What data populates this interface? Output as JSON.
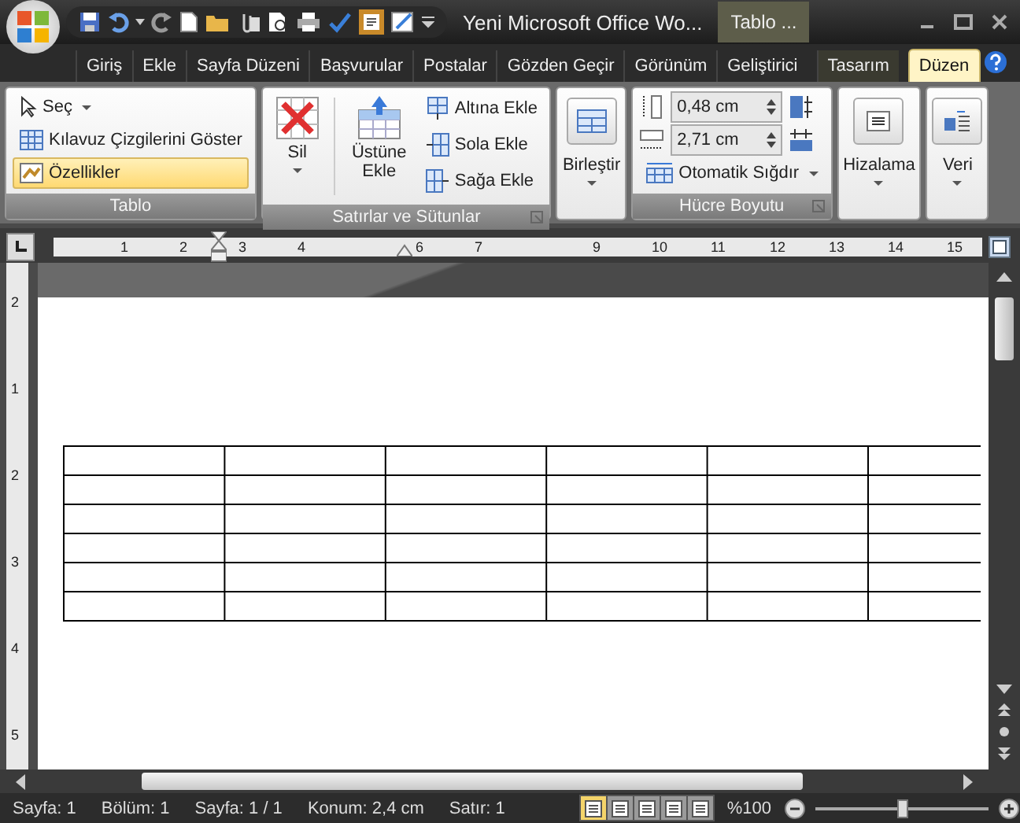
{
  "window": {
    "title": "Yeni Microsoft Office Wo...",
    "context_tab": "Tablo ..."
  },
  "tabs": [
    {
      "label": "Giriş",
      "selected": false,
      "kind": "main"
    },
    {
      "label": "Ekle",
      "selected": false,
      "kind": "main"
    },
    {
      "label": "Sayfa Düzeni",
      "selected": false,
      "kind": "main"
    },
    {
      "label": "Başvurular",
      "selected": false,
      "kind": "main"
    },
    {
      "label": "Postalar",
      "selected": false,
      "kind": "main"
    },
    {
      "label": "Gözden Geçir",
      "selected": false,
      "kind": "main"
    },
    {
      "label": "Görünüm",
      "selected": false,
      "kind": "main"
    },
    {
      "label": "Geliştirici",
      "selected": false,
      "kind": "main"
    },
    {
      "label": "Tasarım",
      "selected": false,
      "kind": "context"
    },
    {
      "label": "Düzen",
      "selected": true,
      "kind": "context"
    }
  ],
  "ribbon": {
    "table_group": {
      "label": "Tablo",
      "items": [
        {
          "label": "Seç",
          "kind": "dropdown",
          "selected": false
        },
        {
          "label": "Kılavuz Çizgilerini Göster",
          "kind": "grid",
          "selected": false
        },
        {
          "label": "Özellikler",
          "kind": "properties",
          "selected": true
        }
      ]
    },
    "rows_columns": {
      "label": "Satırlar ve Sütunlar",
      "delete": "Sil",
      "insert_above": "Üstüne Ekle",
      "small": [
        {
          "label": "Altına Ekle",
          "kind": "below"
        },
        {
          "label": "Sola Ekle",
          "kind": "left"
        },
        {
          "label": "Sağa Ekle",
          "kind": "right"
        }
      ]
    },
    "merge": "Birleştir",
    "cell_size": {
      "label": "Hücre Boyutu",
      "height": "0,48 cm",
      "width": "2,71 cm",
      "autofit": "Otomatik Sığdır"
    },
    "alignment": "Hizalama",
    "data": "Veri"
  },
  "ruler": {
    "numbers": [
      "1",
      "2",
      "3",
      "4",
      "6",
      "7",
      "9",
      "10",
      "11",
      "12",
      "13",
      "14",
      "15"
    ]
  },
  "vertical_ruler": {
    "numbers": [
      "2",
      "1",
      "2",
      "3",
      "4",
      "5"
    ]
  },
  "status_bar": {
    "items": [
      "Sayfa: 1",
      "Bölüm: 1",
      "Sayfa: 1 / 1",
      "Konum: 2,4 cm",
      "Satır: 1"
    ],
    "views": [
      {
        "selected": true
      },
      {
        "selected": false
      },
      {
        "selected": false
      },
      {
        "selected": false
      },
      {
        "selected": false
      }
    ],
    "zoom": "%100",
    "zoom_level": {
      "level": 0.5
    }
  }
}
